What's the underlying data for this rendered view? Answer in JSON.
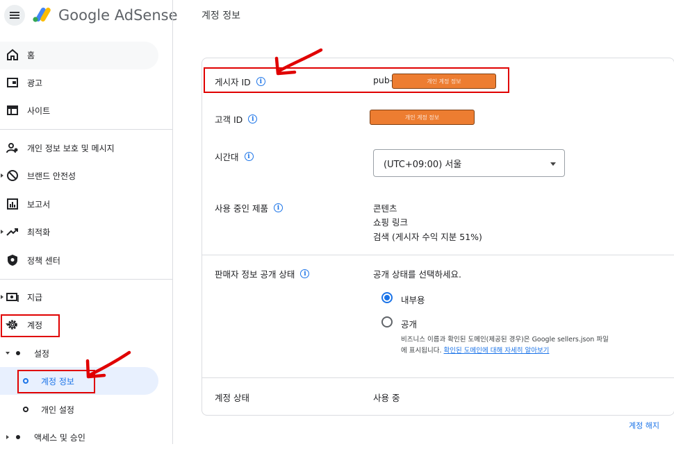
{
  "header": {
    "brand_google": "Google",
    "brand_product": "AdSense",
    "page_title": "계정 정보"
  },
  "sidebar": {
    "items": [
      {
        "label": "홈",
        "icon": "home-icon"
      },
      {
        "label": "광고",
        "icon": "ads-icon"
      },
      {
        "label": "사이트",
        "icon": "sites-icon"
      },
      {
        "label": "개인 정보 보호 및 메시지",
        "icon": "privacy-messaging-icon"
      },
      {
        "label": "브랜드 안전성",
        "icon": "block-icon"
      },
      {
        "label": "보고서",
        "icon": "reports-icon"
      },
      {
        "label": "최적화",
        "icon": "trending-up-icon"
      },
      {
        "label": "정책 센터",
        "icon": "policy-shield-icon"
      },
      {
        "label": "지급",
        "icon": "payments-icon"
      },
      {
        "label": "계정",
        "icon": "gear-icon"
      },
      {
        "label": "설정",
        "icon": "dot-icon"
      },
      {
        "label": "계정 정보",
        "icon": "ring-icon"
      },
      {
        "label": "개인 설정",
        "icon": "ring-icon"
      },
      {
        "label": "액세스 및 승인",
        "icon": "dot-icon"
      }
    ]
  },
  "account": {
    "publisher_id_label": "게시자 ID",
    "publisher_id_prefix": "pub-",
    "redacted_text_1": "개인 계정 정보",
    "customer_id_label": "고객 ID",
    "redacted_text_2": "개인 계정 정보",
    "timezone_label": "시간대",
    "timezone_value": "(UTC+09:00) 서울",
    "products_label": "사용 중인 제품",
    "products": [
      "콘텐츠",
      "쇼핑 링크",
      "검색 (게시자 수익 지분 51%)"
    ],
    "seller_label": "판매자 정보 공개 상태",
    "seller_prompt": "공개 상태를 선택하세요.",
    "radio_internal": "내부용",
    "radio_public": "공개",
    "public_note_line1": "비즈니스 이름과 확인된 도메인(제공된 경우)은 Google sellers.json 파일",
    "public_note_line2_prefix": "에 표시됩니다. ",
    "public_note_link": "확인된 도메인에 대해 자세히 알아보기",
    "status_label": "계정 상태",
    "status_value": "사용 중",
    "close_account": "계정 해지"
  },
  "colors": {
    "accent": "#1a73e8",
    "annotation_red": "#e00000",
    "redaction_orange": "#ed7d31"
  }
}
